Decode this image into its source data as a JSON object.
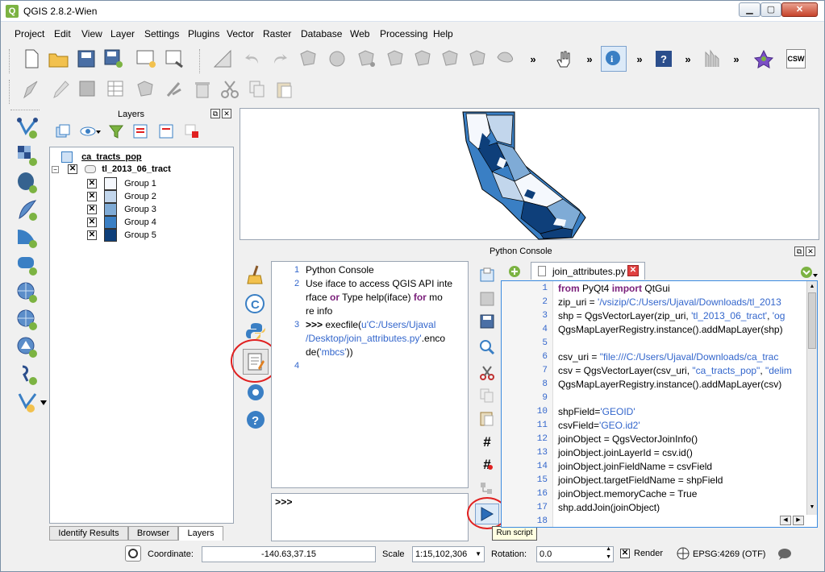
{
  "window": {
    "title": "QGIS 2.8.2-Wien"
  },
  "menu": [
    "Project",
    "Edit",
    "View",
    "Layer",
    "Settings",
    "Plugins",
    "Vector",
    "Raster",
    "Database",
    "Web",
    "Processing",
    "Help"
  ],
  "toolbar": {
    "more_glyph": "»",
    "csw_label": "CSW"
  },
  "layers_panel": {
    "title": "Layers",
    "tree": [
      {
        "name": "ca_tracts_pop",
        "type": "table"
      },
      {
        "name": "tl_2013_06_tract",
        "type": "polygon",
        "checked": true
      }
    ],
    "groups": [
      {
        "label": "Group 1",
        "color": "#f5f8fd"
      },
      {
        "label": "Group 2",
        "color": "#c2d6ec"
      },
      {
        "label": "Group 3",
        "color": "#7fabd6"
      },
      {
        "label": "Group 4",
        "color": "#3a7fc4"
      },
      {
        "label": "Group 5",
        "color": "#0e3f7a"
      }
    ],
    "tabs": [
      "Identify Results",
      "Browser",
      "Layers"
    ],
    "active_tab": "Layers"
  },
  "python_console": {
    "title": "Python Console",
    "output": {
      "line1": "Python Console",
      "line2a": "Use iface to access QGIS API inte",
      "line2b": "rface ",
      "line2c": "or",
      "line2d": " Type help(iface) ",
      "line2e": "for",
      "line2f": " mo",
      "line2g": "re info",
      "line3a": ">>> ",
      "line3b": "execfile(",
      "line3c": "u'C:/Users/Ujaval",
      "line3d": "/Desktop/join_attributes.py'",
      "line3e": ".enco",
      "line3f": "de(",
      "line3g": "'mbcs'",
      "line3h": "))",
      "numbers": [
        "1",
        "2",
        "3",
        "4"
      ]
    },
    "prompt": ">>>",
    "editor_tab": "join_attributes.py",
    "editor_lines": [
      "from PyQt4 import QtGui",
      "zip_uri = '/vsizip/C:/Users/Ujaval/Downloads/tl_2013",
      "shp =  QgsVectorLayer(zip_uri, 'tl_2013_06_tract', 'og",
      "QgsMapLayerRegistry.instance().addMapLayer(shp)",
      "",
      "csv_uri = \"file:///C:/Users/Ujaval/Downloads/ca_trac",
      "csv = QgsVectorLayer(csv_uri, \"ca_tracts_pop\", \"delim",
      "QgsMapLayerRegistry.instance().addMapLayer(csv)",
      "",
      "shpField='GEOID'",
      "csvField='GEO.id2'",
      "joinObject = QgsVectorJoinInfo()",
      "joinObject.joinLayerId = csv.id()",
      "joinObject.joinFieldName = csvField",
      "joinObject.targetFieldName = shpField",
      "joinObject.memoryCache = True",
      "shp.addJoin(joinObject)",
      ""
    ],
    "editor_line_numbers": [
      "1",
      "2",
      "3",
      "4",
      "5",
      "6",
      "7",
      "8",
      "9",
      "10",
      "11",
      "12",
      "13",
      "14",
      "15",
      "16",
      "17",
      "18"
    ],
    "run_tooltip": "Run script"
  },
  "statusbar": {
    "coordinate_label": "Coordinate:",
    "coordinate_value": "-140.63,37.15",
    "scale_label": "Scale",
    "scale_value": "1:15,102,306",
    "rotation_label": "Rotation:",
    "rotation_value": "0.0",
    "render_label": "Render",
    "crs": "EPSG:4269 (OTF)"
  },
  "colors": {
    "accent": "#3b8be0",
    "highlight": "#e02020"
  }
}
